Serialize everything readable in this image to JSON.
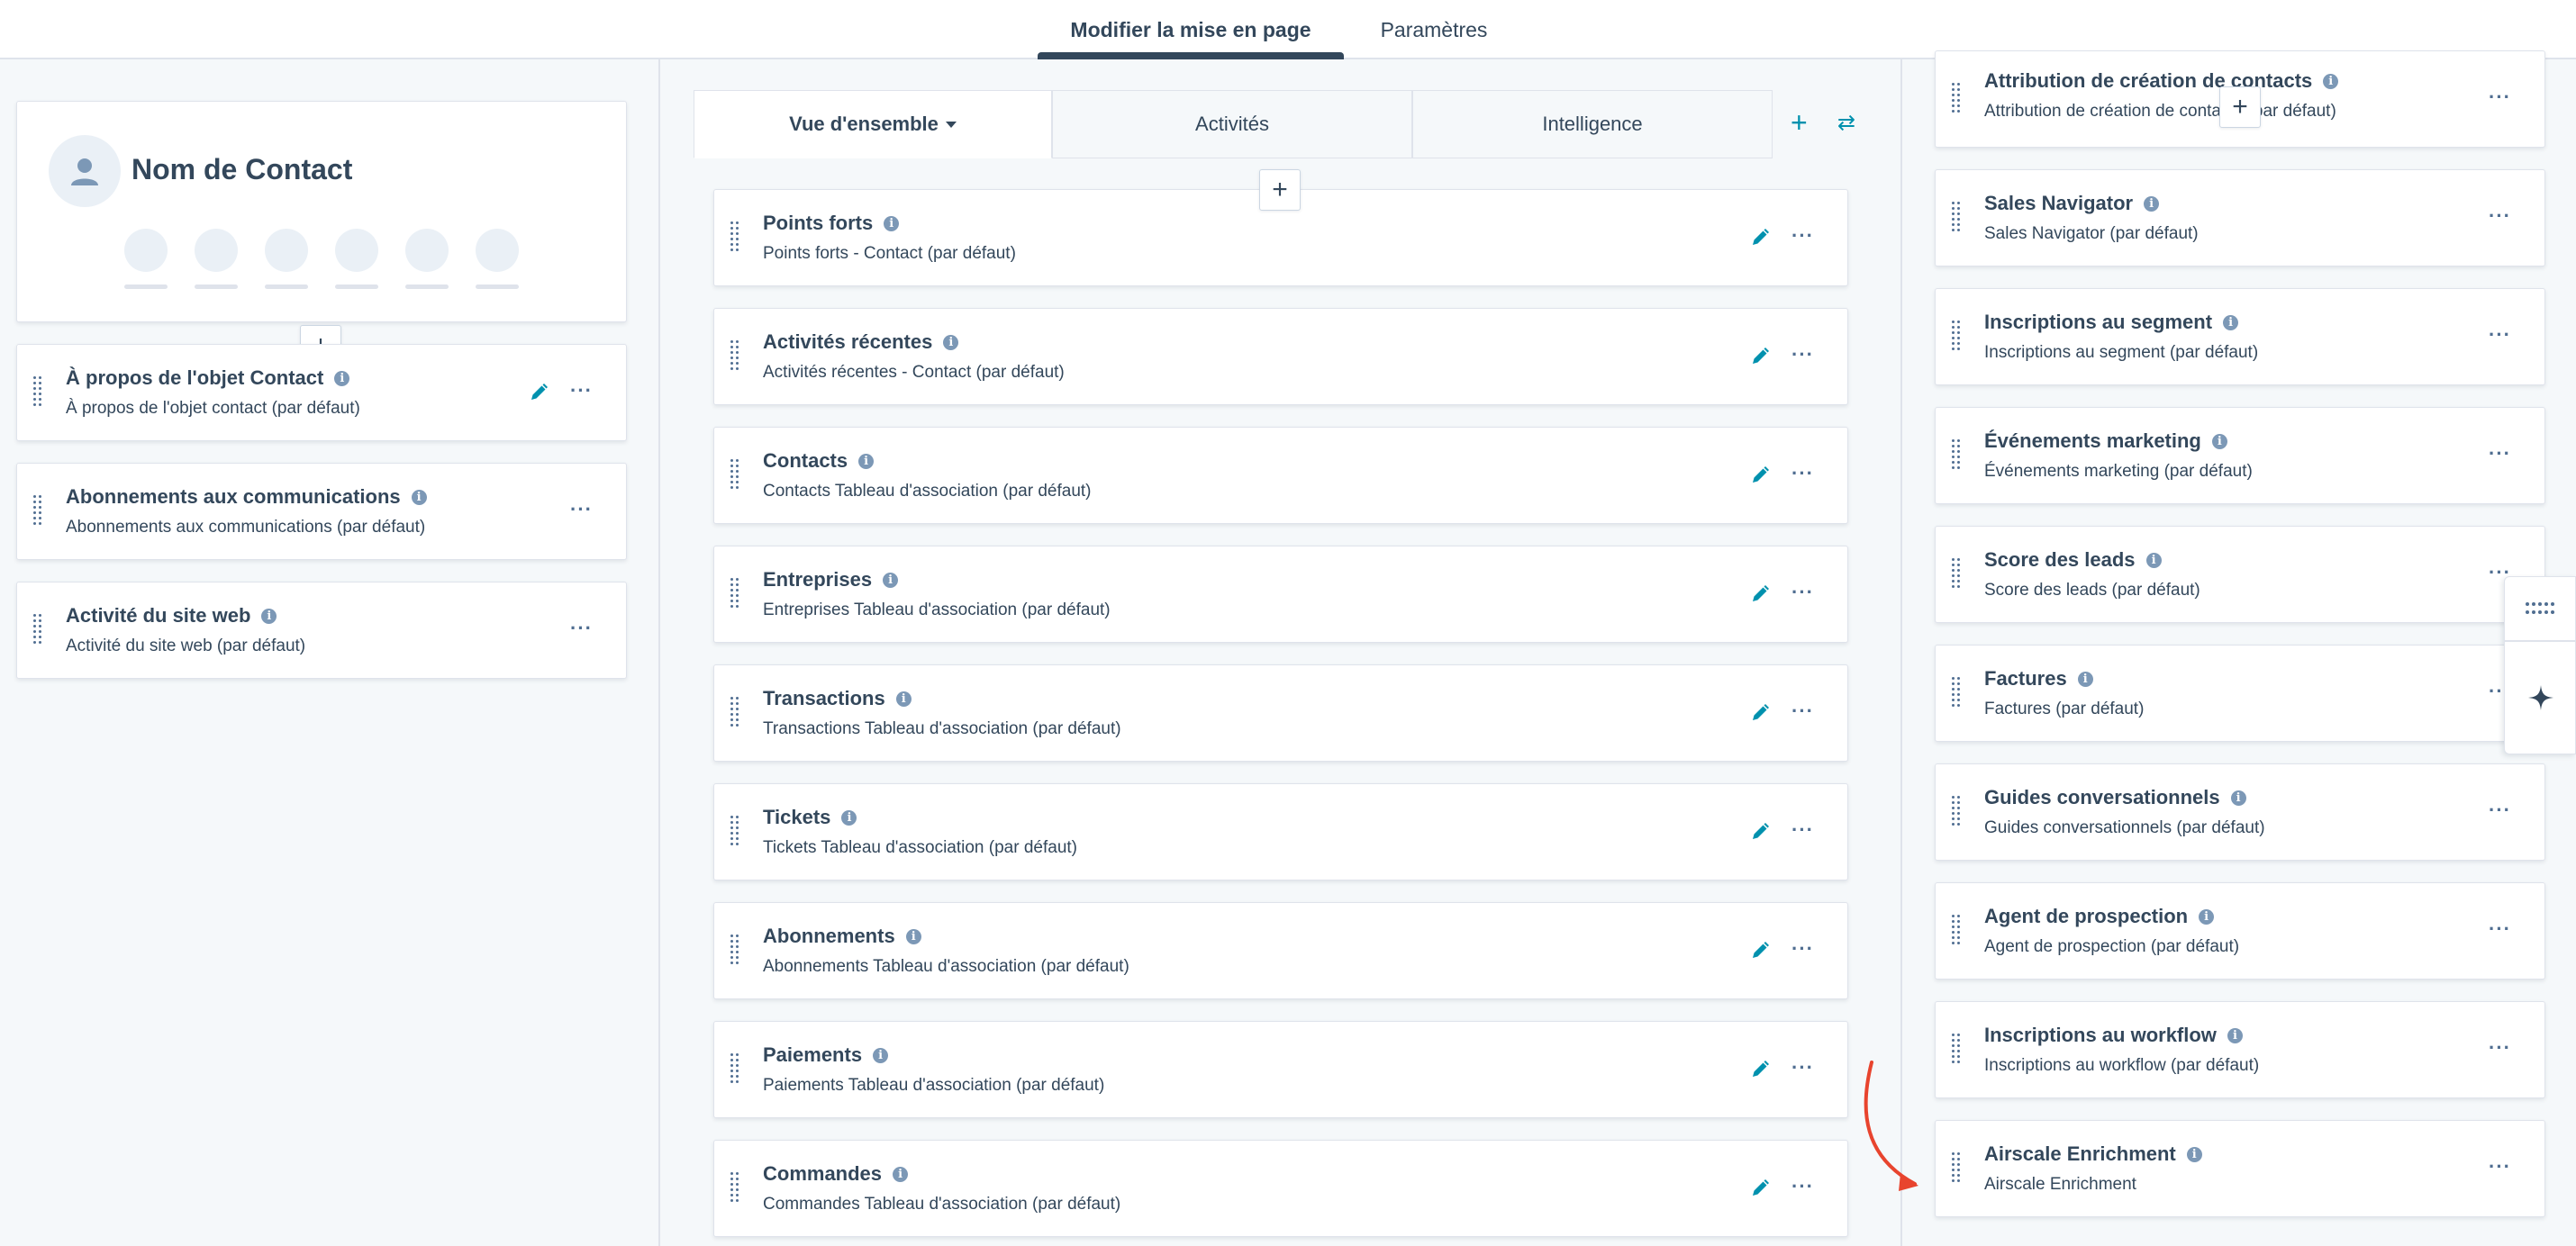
{
  "top_tabs": {
    "edit_layout": "Modifier la mise en page",
    "settings": "Paramètres"
  },
  "contact": {
    "name": "Nom de Contact"
  },
  "left_cards": [
    {
      "title": "À propos de l'objet Contact",
      "subtitle": "À propos de l'objet contact (par défaut)",
      "editable": true
    },
    {
      "title": "Abonnements aux communications",
      "subtitle": "Abonnements aux communications (par défaut)",
      "editable": false
    },
    {
      "title": "Activité du site web",
      "subtitle": "Activité du site web (par défaut)",
      "editable": false
    }
  ],
  "middle_tabs": [
    {
      "label": "Vue d'ensemble",
      "active": true
    },
    {
      "label": "Activités",
      "active": false
    },
    {
      "label": "Intelligence",
      "active": false
    }
  ],
  "middle_cards": [
    {
      "title": "Points forts",
      "subtitle": "Points forts - Contact (par défaut)"
    },
    {
      "title": "Activités récentes",
      "subtitle": "Activités récentes - Contact (par défaut)"
    },
    {
      "title": "Contacts",
      "subtitle": "Contacts Tableau d'association (par défaut)"
    },
    {
      "title": "Entreprises",
      "subtitle": "Entreprises Tableau d'association (par défaut)"
    },
    {
      "title": "Transactions",
      "subtitle": "Transactions Tableau d'association (par défaut)"
    },
    {
      "title": "Tickets",
      "subtitle": "Tickets Tableau d'association (par défaut)"
    },
    {
      "title": "Abonnements",
      "subtitle": "Abonnements Tableau d'association (par défaut)"
    },
    {
      "title": "Paiements",
      "subtitle": "Paiements Tableau d'association (par défaut)"
    },
    {
      "title": "Commandes",
      "subtitle": "Commandes Tableau d'association (par défaut)"
    }
  ],
  "right_cards": [
    {
      "title": "Attribution de création de contacts",
      "subtitle": "Attribution de création de contacts (par défaut)"
    },
    {
      "title": "Sales Navigator",
      "subtitle": "Sales Navigator (par défaut)"
    },
    {
      "title": "Inscriptions au segment",
      "subtitle": "Inscriptions au segment (par défaut)"
    },
    {
      "title": "Événements marketing",
      "subtitle": "Événements marketing (par défaut)"
    },
    {
      "title": "Score des leads",
      "subtitle": "Score des leads (par défaut)"
    },
    {
      "title": "Factures",
      "subtitle": "Factures (par défaut)"
    },
    {
      "title": "Guides conversationnels",
      "subtitle": "Guides conversationnels (par défaut)"
    },
    {
      "title": "Agent de prospection",
      "subtitle": "Agent de prospection (par défaut)"
    },
    {
      "title": "Inscriptions au workflow",
      "subtitle": "Inscriptions au workflow (par défaut)"
    },
    {
      "title": "Airscale Enrichment",
      "subtitle": "Airscale Enrichment"
    }
  ],
  "colors": {
    "accent": "#0091ae",
    "text": "#33475b",
    "border": "#dfe3eb",
    "annotation_arrow": "#e8442e"
  }
}
